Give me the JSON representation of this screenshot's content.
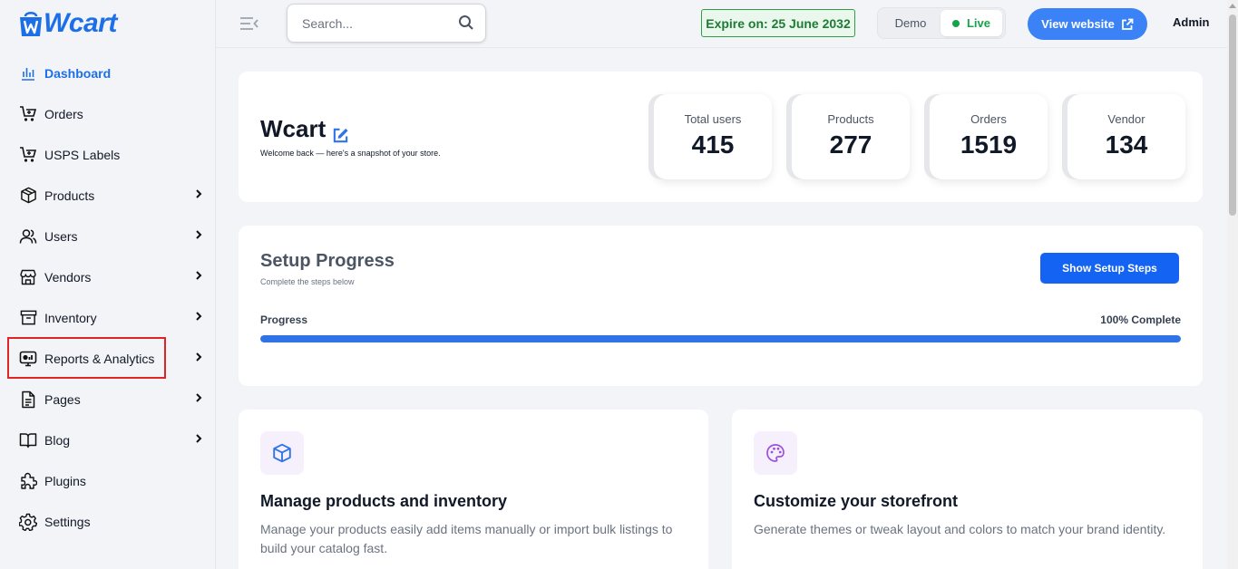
{
  "brand": {
    "logo_text": "Wcart",
    "accent": "#1d6fe8"
  },
  "sidebar": {
    "items": [
      {
        "label": "Dashboard",
        "icon": "chart-bars-icon",
        "active": true,
        "has_submenu": false
      },
      {
        "label": "Orders",
        "icon": "cart-icon",
        "active": false,
        "has_submenu": false
      },
      {
        "label": "USPS Labels",
        "icon": "cart-icon",
        "active": false,
        "has_submenu": false
      },
      {
        "label": "Products",
        "icon": "box-icon",
        "active": false,
        "has_submenu": true
      },
      {
        "label": "Users",
        "icon": "users-icon",
        "active": false,
        "has_submenu": true
      },
      {
        "label": "Vendors",
        "icon": "store-icon",
        "active": false,
        "has_submenu": true
      },
      {
        "label": "Inventory",
        "icon": "archive-icon",
        "active": false,
        "has_submenu": true
      },
      {
        "label": "Reports & Analytics",
        "icon": "monitor-chart-icon",
        "active": false,
        "has_submenu": true
      },
      {
        "label": "Pages",
        "icon": "document-icon",
        "active": false,
        "has_submenu": true
      },
      {
        "label": "Blog",
        "icon": "book-icon",
        "active": false,
        "has_submenu": true
      },
      {
        "label": "Plugins",
        "icon": "puzzle-icon",
        "active": false,
        "has_submenu": false
      },
      {
        "label": "Settings",
        "icon": "gear-icon",
        "active": false,
        "has_submenu": false
      }
    ]
  },
  "topbar": {
    "search_placeholder": "Search...",
    "expire_text": "Expire on: 25 June 2032",
    "mode": {
      "demo_label": "Demo",
      "live_label": "Live",
      "selected": "Live"
    },
    "view_website_label": "View website",
    "user_label": "Admin"
  },
  "hero": {
    "title": "Wcart",
    "subtitle": "Welcome back — here's a snapshot of your store.",
    "stats": [
      {
        "label": "Total users",
        "value": "415"
      },
      {
        "label": "Products",
        "value": "277"
      },
      {
        "label": "Orders",
        "value": "1519"
      },
      {
        "label": "Vendor",
        "value": "134"
      }
    ]
  },
  "setup": {
    "title": "Setup Progress",
    "subtitle": "Complete the steps below",
    "button_label": "Show Setup Steps",
    "progress_label": "Progress",
    "progress_text": "100% Complete",
    "progress_fraction": 1.0
  },
  "features": [
    {
      "icon": "box-icon",
      "title": "Manage products and inventory",
      "description": "Manage your products easily add items manually or import bulk listings to build your catalog fast."
    },
    {
      "icon": "palette-icon",
      "title": "Customize your storefront",
      "description": "Generate themes or tweak layout and colors to match your brand identity."
    }
  ]
}
